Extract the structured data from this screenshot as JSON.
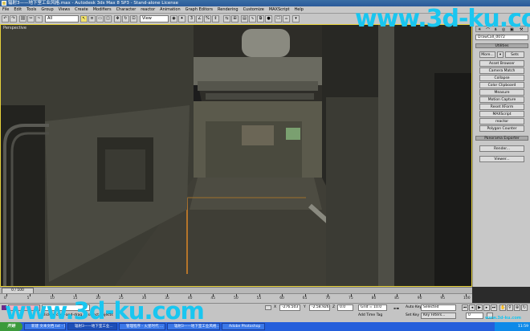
{
  "titlebar": {
    "title": "辐射3——地下室工业风格.max - Autodesk 3ds Max 8 SP3  - Stand-alone License"
  },
  "menubar": {
    "items": [
      "File",
      "Edit",
      "Tools",
      "Group",
      "Views",
      "Create",
      "Modifiers",
      "Character",
      "reactor",
      "Animation",
      "Graph Editors",
      "Rendering",
      "Customize",
      "MAXScript",
      "Help"
    ]
  },
  "toolbar": {
    "selection_filter": "All",
    "coord_system": "View"
  },
  "viewport": {
    "label": "Perspective"
  },
  "command_panel": {
    "object_name": "DrawCall_0072",
    "rollouts": [
      {
        "title": "Utilities"
      },
      {
        "title": "Panorama Exporter"
      }
    ],
    "more_label": "More...",
    "sets_label": "Sets",
    "utility_buttons": [
      "Asset Browser",
      "Camera Match",
      "Collapse",
      "Color Clipboard",
      "Measure",
      "Motion Capture",
      "Reset XForm",
      "MAXScript",
      "reactor",
      "Polygon Counter"
    ],
    "panorama_buttons": [
      "Render...",
      "Viewer..."
    ]
  },
  "timeline": {
    "frame_indicator": "0 / 100",
    "ticks": [
      "0",
      "5",
      "10",
      "15",
      "20",
      "25",
      "30",
      "35",
      "40",
      "45",
      "50",
      "55",
      "60",
      "65",
      "70",
      "75",
      "80",
      "85",
      "90",
      "95",
      "100"
    ]
  },
  "statusbar": {
    "prompt": "Click or click-and-drag to select objects",
    "x_label": "X",
    "x_value": "-276.503",
    "y_label": "Y",
    "y_value": "-2.58.926",
    "z_label": "Z",
    "z_value": "0.0",
    "grid_label": "Grid = 10.0",
    "add_time_tag": "Add Time Tag",
    "auto_key": "Auto Key",
    "selected": "Selected",
    "set_key": "Set Key",
    "key_filters": "Key Filters...",
    "frame_field": "0"
  },
  "taskbar": {
    "start": "开始",
    "tasks": [
      "新建 文本文档.txt - 记...",
      "辐射3——地下室工业...",
      "管理程序 - 火星时代 ...",
      "辐射3——地下室工业风格...",
      "Adobe Photoshop"
    ],
    "clock": "11:59"
  },
  "watermarks": {
    "top": "www.3d-ku.com",
    "bottom": "www.3d-ku.com",
    "small": "www.3d-ku.com"
  },
  "colors": {
    "watermark": "#19c6f0",
    "viewport_border": "#e7d23b",
    "title_bar": "#2a5a9a"
  }
}
